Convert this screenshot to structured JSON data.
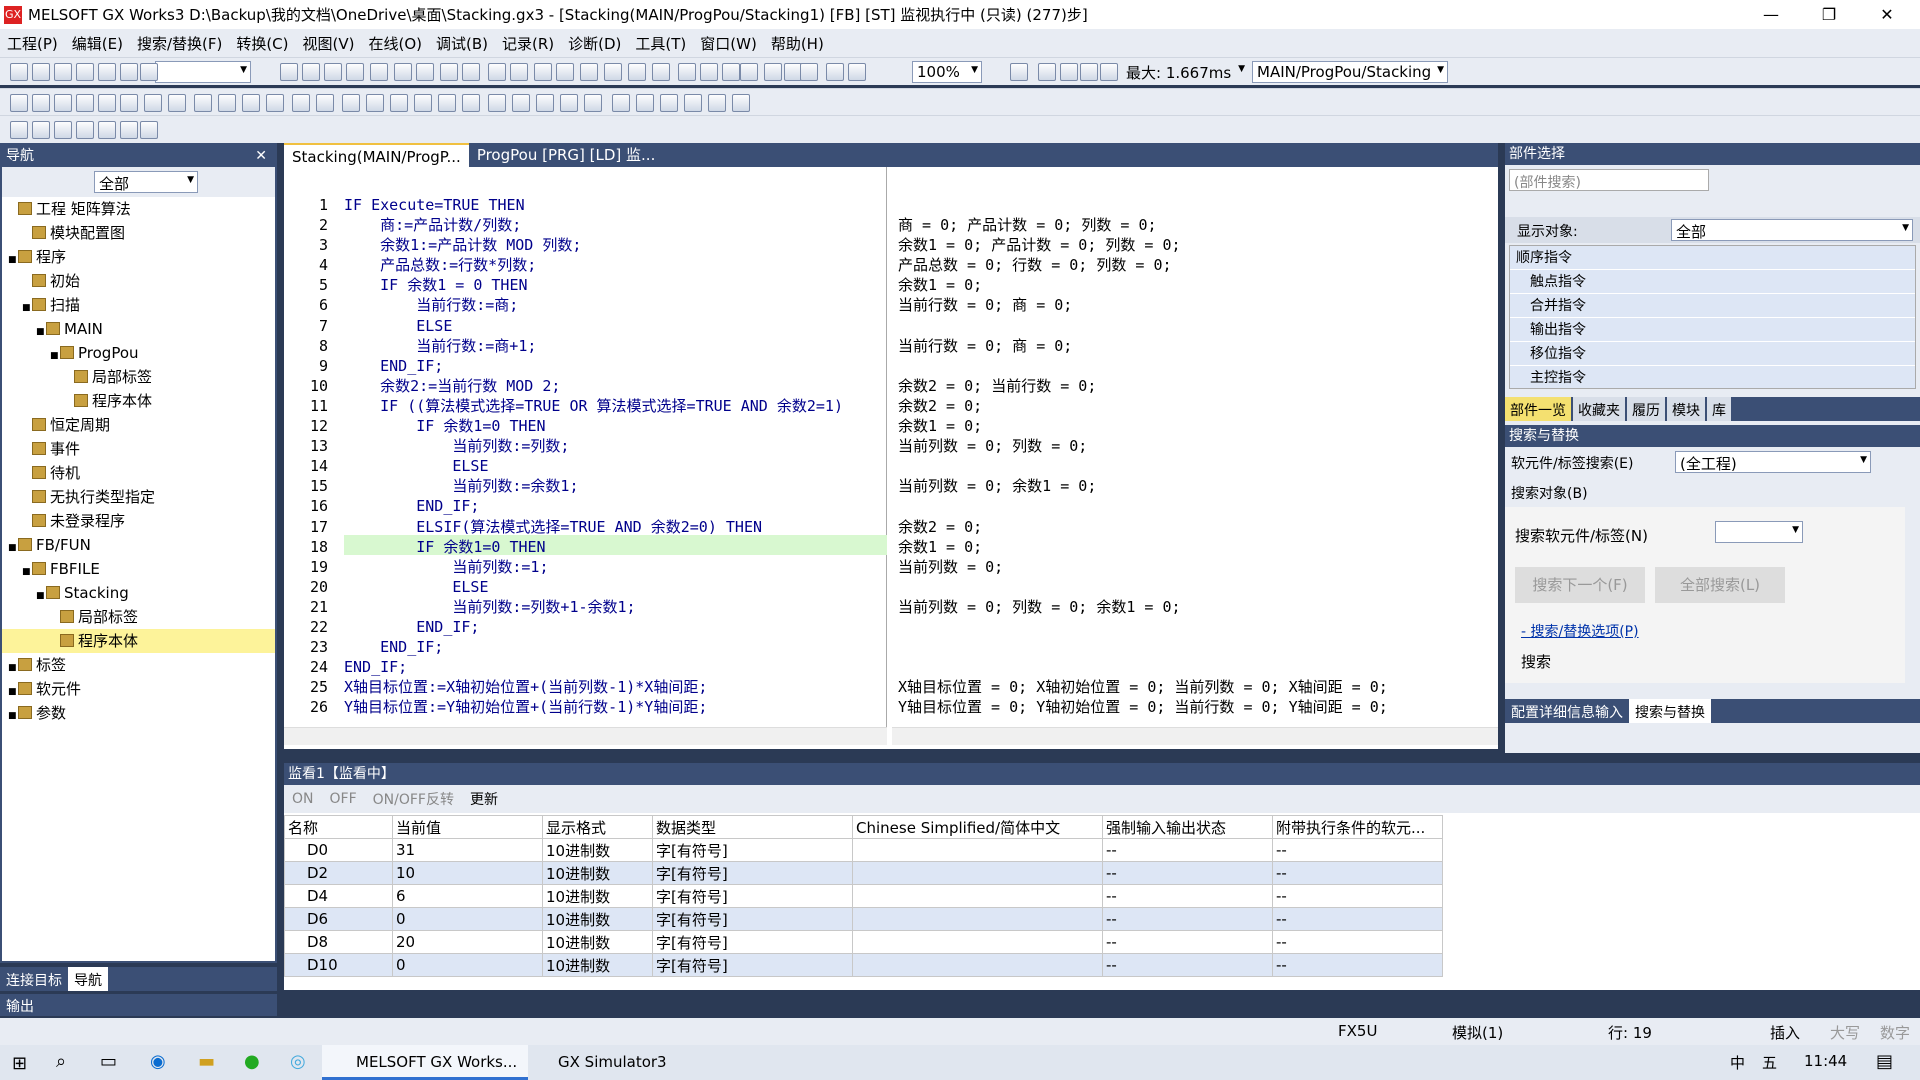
{
  "window": {
    "title": "MELSOFT GX Works3 D:\\Backup\\我的文档\\OneDrive\\桌面\\Stacking.gx3 - [Stacking(MAIN/ProgPou/Stacking1) [FB] [ST] 监视执行中 (只读) (277)步]",
    "minimize": "—",
    "restore": "❐",
    "close": "✕",
    "app_icon": "GX"
  },
  "menu": [
    "工程(P)",
    "编辑(E)",
    "搜索/替换(F)",
    "转换(C)",
    "视图(V)",
    "在线(O)",
    "调试(B)",
    "记录(R)",
    "诊断(D)",
    "工具(T)",
    "窗口(W)",
    "帮助(H)"
  ],
  "toolbar": {
    "zoom": "100%",
    "scan_max": "最大: 1.667ms",
    "pou_path": "MAIN/ProgPou/Stacking"
  },
  "nav": {
    "title": "导航",
    "filter": "全部",
    "tree": [
      {
        "label": "工程 矩阵算法",
        "level": 0,
        "exp": ""
      },
      {
        "label": "模块配置图",
        "level": 1,
        "exp": ""
      },
      {
        "label": "程序",
        "level": 0,
        "exp": "■"
      },
      {
        "label": "初始",
        "level": 1,
        "exp": ""
      },
      {
        "label": "扫描",
        "level": 1,
        "exp": "■"
      },
      {
        "label": "MAIN",
        "level": 2,
        "exp": "■"
      },
      {
        "label": "ProgPou",
        "level": 3,
        "exp": "■"
      },
      {
        "label": "局部标签",
        "level": 4,
        "exp": ""
      },
      {
        "label": "程序本体",
        "level": 4,
        "exp": ""
      },
      {
        "label": "恒定周期",
        "level": 1,
        "exp": ""
      },
      {
        "label": "事件",
        "level": 1,
        "exp": ""
      },
      {
        "label": "待机",
        "level": 1,
        "exp": ""
      },
      {
        "label": "无执行类型指定",
        "level": 1,
        "exp": ""
      },
      {
        "label": "未登录程序",
        "level": 1,
        "exp": ""
      },
      {
        "label": "FB/FUN",
        "level": 0,
        "exp": "■"
      },
      {
        "label": "FBFILE",
        "level": 1,
        "exp": "■"
      },
      {
        "label": "Stacking",
        "level": 2,
        "exp": "■"
      },
      {
        "label": "局部标签",
        "level": 3,
        "exp": ""
      },
      {
        "label": "程序本体",
        "level": 3,
        "exp": "",
        "selected": true
      },
      {
        "label": "标签",
        "level": 0,
        "exp": "■"
      },
      {
        "label": "软元件",
        "level": 0,
        "exp": "■"
      },
      {
        "label": "参数",
        "level": 0,
        "exp": "■"
      }
    ],
    "bottom_tabs": [
      "连接目标",
      "导航"
    ],
    "output": "输出"
  },
  "editor": {
    "tabs": [
      "Stacking(MAIN/ProgP...",
      "ProgPou [PRG] [LD] 监..."
    ],
    "lines": [
      "IF Execute=TRUE THEN",
      "    商:=产品计数/列数;",
      "    余数1:=产品计数 MOD 列数;",
      "    产品总数:=行数*列数;",
      "    IF 余数1 = 0 THEN",
      "        当前行数:=商;",
      "        ELSE",
      "        当前行数:=商+1;",
      "    END_IF;",
      "    余数2:=当前行数 MOD 2;",
      "    IF ((算法模式选择=TRUE OR 算法模式选择=TRUE AND 余数2=1)",
      "        IF 余数1=0 THEN",
      "            当前列数:=列数;",
      "            ELSE",
      "            当前列数:=余数1;",
      "        END_IF;",
      "        ELSIF(算法模式选择=TRUE AND 余数2=0) THEN",
      "        IF 余数1=0 THEN",
      "            当前列数:=1;",
      "            ELSE",
      "            当前列数:=列数+1-余数1;",
      "        END_IF;",
      "    END_IF;",
      "END_IF;",
      "X轴目标位置:=X轴初始位置+(当前列数-1)*X轴间距;",
      "Y轴目标位置:=Y轴初始位置+(当前行数-1)*Y轴间距;"
    ],
    "monitor": [
      "",
      "商 = 0; 产品计数 = 0; 列数 = 0;",
      "余数1 = 0; 产品计数 = 0; 列数 = 0;",
      "产品总数 = 0; 行数 = 0; 列数 = 0;",
      "余数1 = 0;",
      "当前行数 = 0; 商 = 0;",
      "",
      "当前行数 = 0; 商 = 0;",
      "",
      "余数2 = 0; 当前行数 = 0;",
      "余数2 = 0;",
      "余数1 = 0;",
      "当前列数 = 0; 列数 = 0;",
      "",
      "当前列数 = 0; 余数1 = 0;",
      "",
      "余数2 = 0;",
      "余数1 = 0;",
      "当前列数 = 0;",
      "",
      "当前列数 = 0; 列数 = 0; 余数1 = 0;",
      "",
      "",
      "",
      "X轴目标位置 = 0; X轴初始位置 = 0; 当前列数 = 0; X轴间距 = 0;",
      "Y轴目标位置 = 0; Y轴初始位置 = 0; 当前行数 = 0; Y轴间距 = 0;"
    ]
  },
  "parts": {
    "title": "部件选择",
    "search_placeholder": "(部件搜索)",
    "display_label": "显示对象:",
    "display_value": "全部",
    "items": [
      "顺序指令",
      "触点指令",
      "合并指令",
      "输出指令",
      "移位指令",
      "主控指令"
    ],
    "tabs": [
      "部件一览",
      "收藏夹",
      "履历",
      "模块",
      "库"
    ]
  },
  "search": {
    "title": "搜索与替换",
    "mode": "软元件/标签搜索(E)",
    "scope": "(全工程)",
    "target": "搜索对象(B)",
    "label": "搜索软元件/标签(N)",
    "next": "搜索下一个(F)",
    "all": "全部搜索(L)",
    "options": "- 搜索/替换选项(P)",
    "search": "搜索",
    "bottom_tabs": [
      "配置详细信息输入",
      "搜索与替换"
    ]
  },
  "watch": {
    "title": "监看1【监看中】",
    "buttons": [
      "ON",
      "OFF",
      "ON/OFF反转",
      "更新"
    ],
    "headers": [
      "名称",
      "当前值",
      "显示格式",
      "数据类型",
      "Chinese Simplified/简体中文",
      "强制输入输出状态",
      "附带执行条件的软元..."
    ],
    "rows": [
      [
        "D0",
        "31",
        "10进制数",
        "字[有符号]",
        "",
        "--",
        "--"
      ],
      [
        "D2",
        "10",
        "10进制数",
        "字[有符号]",
        "",
        "--",
        "--"
      ],
      [
        "D4",
        "6",
        "10进制数",
        "字[有符号]",
        "",
        "--",
        "--"
      ],
      [
        "D6",
        "0",
        "10进制数",
        "字[有符号]",
        "",
        "--",
        "--"
      ],
      [
        "D8",
        "20",
        "10进制数",
        "字[有符号]",
        "",
        "--",
        "--"
      ],
      [
        "D10",
        "0",
        "10进制数",
        "字[有符号]",
        "",
        "--",
        "--"
      ]
    ]
  },
  "status": {
    "cpu": "FX5U",
    "mode": "模拟(1)",
    "row": "行: 19",
    "insert": "插入",
    "caps": "大写",
    "num": "数字"
  },
  "taskbar": {
    "apps": [
      "MELSOFT GX Works...",
      "GX Simulator3"
    ],
    "ime": "中",
    "ime2": "五",
    "time": "11:44"
  }
}
